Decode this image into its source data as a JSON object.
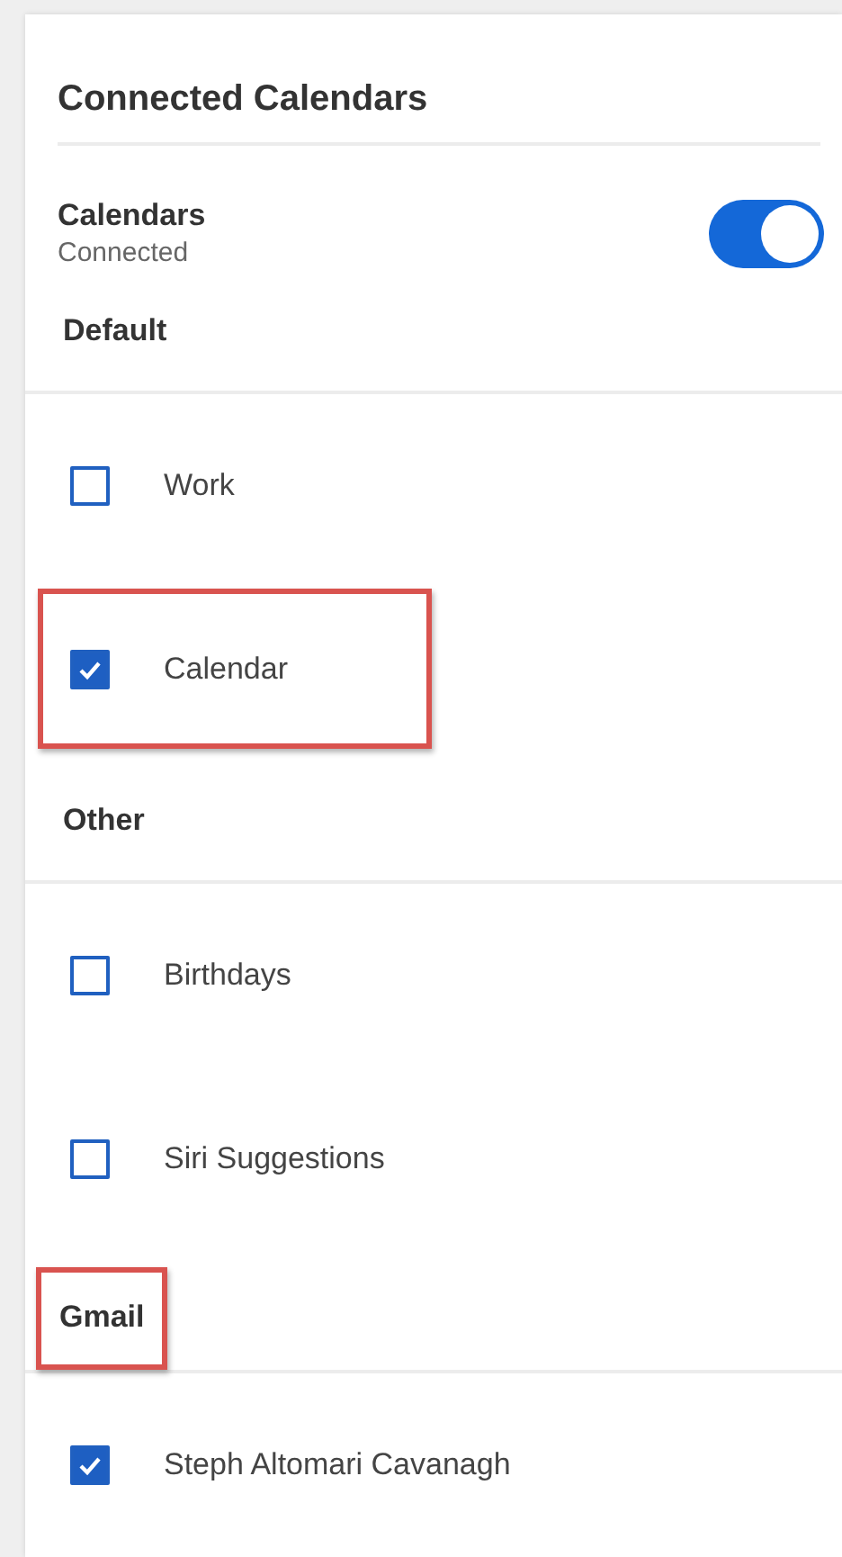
{
  "title": "Connected Calendars",
  "connection": {
    "label": "Calendars",
    "status": "Connected",
    "on": true
  },
  "sections": [
    {
      "title": "Default",
      "highlighted": false,
      "items": [
        {
          "label": "Work",
          "checked": false,
          "highlighted": false
        },
        {
          "label": "Calendar",
          "checked": true,
          "highlighted": true
        }
      ]
    },
    {
      "title": "Other",
      "highlighted": false,
      "items": [
        {
          "label": "Birthdays",
          "checked": false,
          "highlighted": false
        },
        {
          "label": "Siri Suggestions",
          "checked": false,
          "highlighted": false
        }
      ]
    },
    {
      "title": "Gmail",
      "highlighted": true,
      "items": [
        {
          "label": "Steph Altomari Cavanagh",
          "checked": true,
          "highlighted": false
        }
      ]
    }
  ]
}
